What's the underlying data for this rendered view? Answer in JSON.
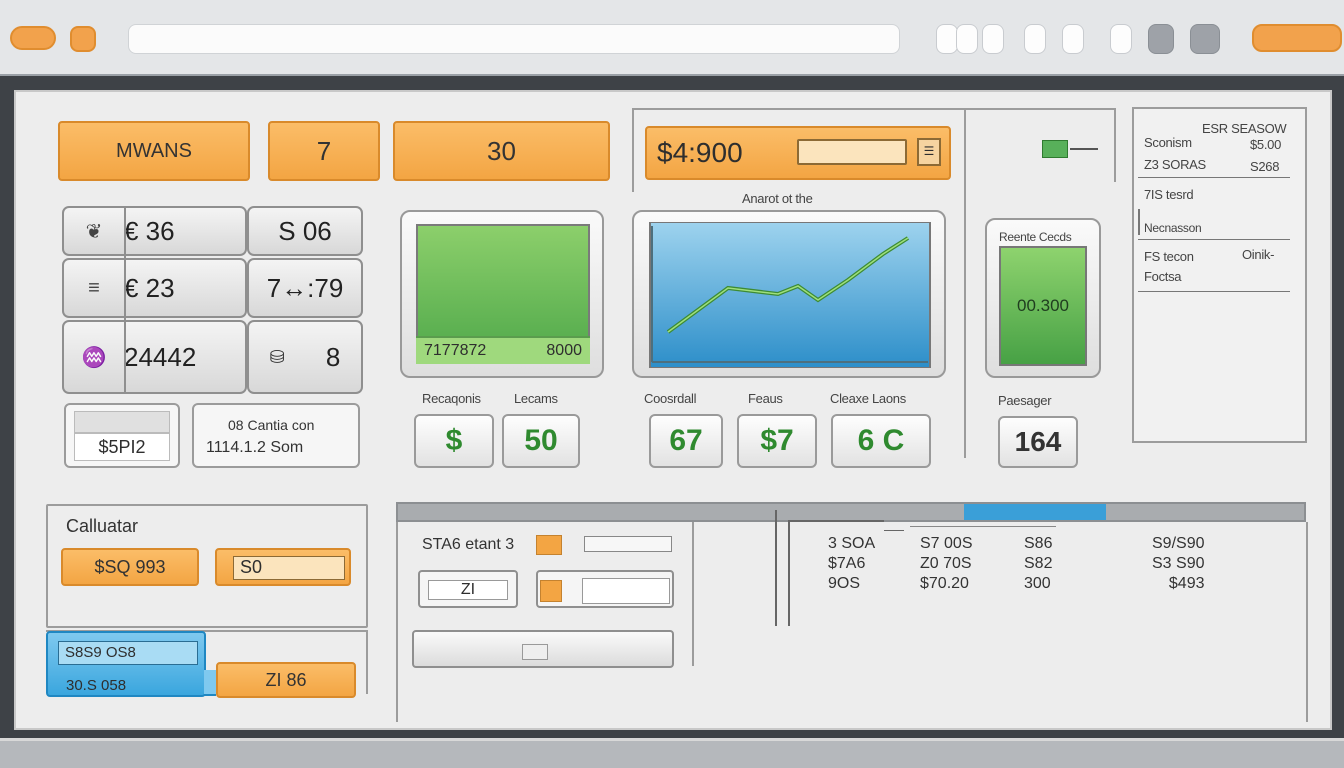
{
  "toolbar": {
    "address_value": ""
  },
  "top_row": {
    "menu_label": "MWANS",
    "field_two": "7",
    "field_three": "30",
    "price_display": "$4:900"
  },
  "keypad": {
    "rows": [
      {
        "icon": "❦",
        "left": "€  36",
        "right": "S  06"
      },
      {
        "icon": "≡",
        "left": "€  23",
        "right": "7↔:79"
      },
      {
        "icon": "♒",
        "left": "24442",
        "right_icon": "⛁",
        "right": "8"
      }
    ]
  },
  "left_boxes": {
    "price": "$5PI2",
    "caption_top": "08 Cantia con",
    "caption_bottom": "1114.1.2 Som"
  },
  "green_panel": {
    "bottom_left": "7177872",
    "bottom_right": "8000",
    "labels": [
      "Recaqonis",
      "Lecams"
    ],
    "values": [
      "$",
      "50"
    ]
  },
  "line_chart": {
    "title": "Anarot ot the",
    "labels": [
      "Coosrdall",
      "Feaus",
      "Cleaxe Laons"
    ],
    "values": [
      "67",
      "$7",
      "6 C"
    ]
  },
  "recent_card": {
    "title": "Reente Cecds",
    "value": "00.300",
    "label": "Paesager",
    "number": "164"
  },
  "right_panel": {
    "title": "ESR SEASOW",
    "rows": [
      {
        "left": "Sconism",
        "right": "$5.00"
      },
      {
        "left": "Z3 SORAS",
        "right": "S268"
      },
      {
        "left": "7IS tesrd",
        "right": ""
      },
      {
        "left": "Necnasson",
        "right": ""
      },
      {
        "left": "FS tecon",
        "right": "Oinik-"
      },
      {
        "left": "Foctsa",
        "right": ""
      }
    ]
  },
  "calculator": {
    "title": "Calluatar",
    "button_one": "$SQ 993",
    "button_two": "S0",
    "blue_top": "S8S9 OS8",
    "blue_bottom": "30.S 058",
    "orange_bottom": "ZI 86"
  },
  "table": {
    "form_label": "STA6 etant 3",
    "input_value": "ZI",
    "columns": [
      [
        "3 SOA",
        "$7A6",
        "9OS"
      ],
      [
        "S7 00S",
        "Z0 70S",
        "$70.20"
      ],
      [
        "S86",
        "S82",
        "300"
      ],
      [
        "S9/S90",
        "S3 S90",
        "$493"
      ]
    ]
  }
}
